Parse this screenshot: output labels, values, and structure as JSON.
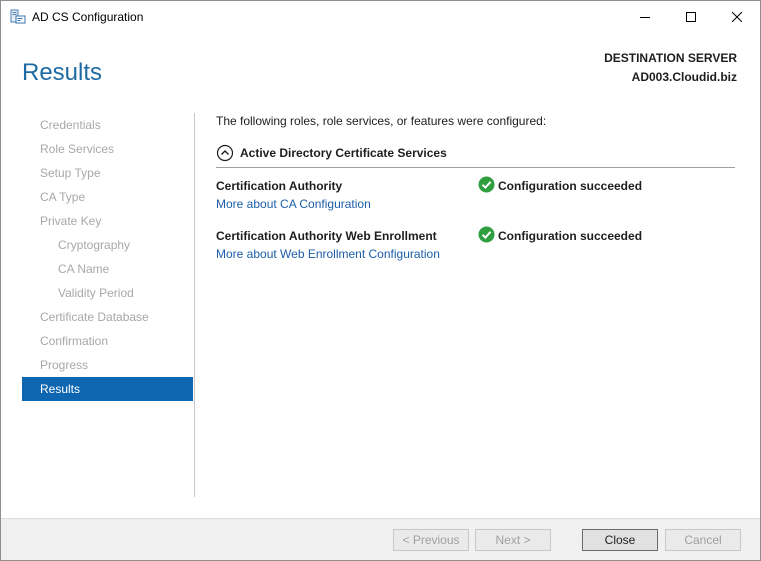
{
  "window": {
    "title": "AD CS Configuration",
    "icons": {
      "app": "certificate-server-icon",
      "minimize": "minimize-icon",
      "maximize": "maximize-icon",
      "close": "close-icon"
    }
  },
  "header": {
    "page_title": "Results",
    "destination_label": "DESTINATION SERVER",
    "destination_server": "AD003.Cloudid.biz"
  },
  "nav": {
    "items": [
      {
        "label": "Credentials",
        "state": "disabled",
        "level": 0
      },
      {
        "label": "Role Services",
        "state": "disabled",
        "level": 0
      },
      {
        "label": "Setup Type",
        "state": "disabled",
        "level": 0
      },
      {
        "label": "CA Type",
        "state": "disabled",
        "level": 0
      },
      {
        "label": "Private Key",
        "state": "disabled",
        "level": 0
      },
      {
        "label": "Cryptography",
        "state": "disabled",
        "level": 1
      },
      {
        "label": "CA Name",
        "state": "disabled",
        "level": 1
      },
      {
        "label": "Validity Period",
        "state": "disabled",
        "level": 1
      },
      {
        "label": "Certificate Database",
        "state": "disabled",
        "level": 0
      },
      {
        "label": "Confirmation",
        "state": "disabled",
        "level": 0
      },
      {
        "label": "Progress",
        "state": "disabled",
        "level": 0
      },
      {
        "label": "Results",
        "state": "active",
        "level": 0
      }
    ]
  },
  "content": {
    "intro": "The following roles, role services, or features were configured:",
    "section": {
      "title": "Active Directory Certificate Services",
      "toggle_icon": "collapse-up-icon",
      "results": [
        {
          "role": "Certification Authority",
          "status": "Configuration succeeded",
          "status_icon": "success-check-icon",
          "link": "More about CA Configuration"
        },
        {
          "role": "Certification Authority Web Enrollment",
          "status": "Configuration succeeded",
          "status_icon": "success-check-icon",
          "link": "More about Web Enrollment Configuration"
        }
      ]
    }
  },
  "footer": {
    "previous": "< Previous",
    "next": "Next >",
    "close": "Close",
    "cancel": "Cancel"
  },
  "colors": {
    "accent": "#0e66b0",
    "title_blue": "#1e6ba4",
    "link": "#1c5ea8",
    "success": "#2e9e3e",
    "disabled_text": "#a8a8a8"
  }
}
